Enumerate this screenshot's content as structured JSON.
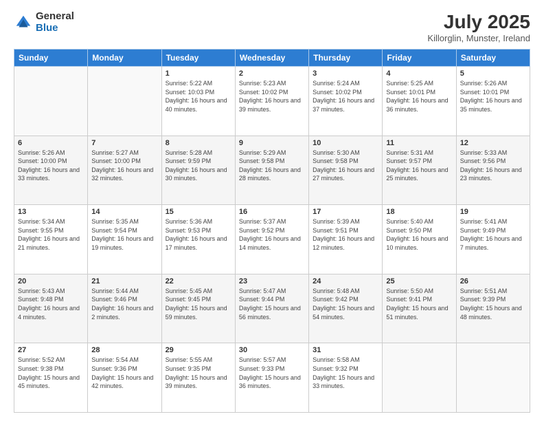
{
  "logo": {
    "general": "General",
    "blue": "Blue"
  },
  "header": {
    "month_year": "July 2025",
    "location": "Killorglin, Munster, Ireland"
  },
  "days_of_week": [
    "Sunday",
    "Monday",
    "Tuesday",
    "Wednesday",
    "Thursday",
    "Friday",
    "Saturday"
  ],
  "weeks": [
    [
      {
        "day": "",
        "sunrise": "",
        "sunset": "",
        "daylight": ""
      },
      {
        "day": "",
        "sunrise": "",
        "sunset": "",
        "daylight": ""
      },
      {
        "day": "1",
        "sunrise": "Sunrise: 5:22 AM",
        "sunset": "Sunset: 10:03 PM",
        "daylight": "Daylight: 16 hours and 40 minutes."
      },
      {
        "day": "2",
        "sunrise": "Sunrise: 5:23 AM",
        "sunset": "Sunset: 10:02 PM",
        "daylight": "Daylight: 16 hours and 39 minutes."
      },
      {
        "day": "3",
        "sunrise": "Sunrise: 5:24 AM",
        "sunset": "Sunset: 10:02 PM",
        "daylight": "Daylight: 16 hours and 37 minutes."
      },
      {
        "day": "4",
        "sunrise": "Sunrise: 5:25 AM",
        "sunset": "Sunset: 10:01 PM",
        "daylight": "Daylight: 16 hours and 36 minutes."
      },
      {
        "day": "5",
        "sunrise": "Sunrise: 5:26 AM",
        "sunset": "Sunset: 10:01 PM",
        "daylight": "Daylight: 16 hours and 35 minutes."
      }
    ],
    [
      {
        "day": "6",
        "sunrise": "Sunrise: 5:26 AM",
        "sunset": "Sunset: 10:00 PM",
        "daylight": "Daylight: 16 hours and 33 minutes."
      },
      {
        "day": "7",
        "sunrise": "Sunrise: 5:27 AM",
        "sunset": "Sunset: 10:00 PM",
        "daylight": "Daylight: 16 hours and 32 minutes."
      },
      {
        "day": "8",
        "sunrise": "Sunrise: 5:28 AM",
        "sunset": "Sunset: 9:59 PM",
        "daylight": "Daylight: 16 hours and 30 minutes."
      },
      {
        "day": "9",
        "sunrise": "Sunrise: 5:29 AM",
        "sunset": "Sunset: 9:58 PM",
        "daylight": "Daylight: 16 hours and 28 minutes."
      },
      {
        "day": "10",
        "sunrise": "Sunrise: 5:30 AM",
        "sunset": "Sunset: 9:58 PM",
        "daylight": "Daylight: 16 hours and 27 minutes."
      },
      {
        "day": "11",
        "sunrise": "Sunrise: 5:31 AM",
        "sunset": "Sunset: 9:57 PM",
        "daylight": "Daylight: 16 hours and 25 minutes."
      },
      {
        "day": "12",
        "sunrise": "Sunrise: 5:33 AM",
        "sunset": "Sunset: 9:56 PM",
        "daylight": "Daylight: 16 hours and 23 minutes."
      }
    ],
    [
      {
        "day": "13",
        "sunrise": "Sunrise: 5:34 AM",
        "sunset": "Sunset: 9:55 PM",
        "daylight": "Daylight: 16 hours and 21 minutes."
      },
      {
        "day": "14",
        "sunrise": "Sunrise: 5:35 AM",
        "sunset": "Sunset: 9:54 PM",
        "daylight": "Daylight: 16 hours and 19 minutes."
      },
      {
        "day": "15",
        "sunrise": "Sunrise: 5:36 AM",
        "sunset": "Sunset: 9:53 PM",
        "daylight": "Daylight: 16 hours and 17 minutes."
      },
      {
        "day": "16",
        "sunrise": "Sunrise: 5:37 AM",
        "sunset": "Sunset: 9:52 PM",
        "daylight": "Daylight: 16 hours and 14 minutes."
      },
      {
        "day": "17",
        "sunrise": "Sunrise: 5:39 AM",
        "sunset": "Sunset: 9:51 PM",
        "daylight": "Daylight: 16 hours and 12 minutes."
      },
      {
        "day": "18",
        "sunrise": "Sunrise: 5:40 AM",
        "sunset": "Sunset: 9:50 PM",
        "daylight": "Daylight: 16 hours and 10 minutes."
      },
      {
        "day": "19",
        "sunrise": "Sunrise: 5:41 AM",
        "sunset": "Sunset: 9:49 PM",
        "daylight": "Daylight: 16 hours and 7 minutes."
      }
    ],
    [
      {
        "day": "20",
        "sunrise": "Sunrise: 5:43 AM",
        "sunset": "Sunset: 9:48 PM",
        "daylight": "Daylight: 16 hours and 4 minutes."
      },
      {
        "day": "21",
        "sunrise": "Sunrise: 5:44 AM",
        "sunset": "Sunset: 9:46 PM",
        "daylight": "Daylight: 16 hours and 2 minutes."
      },
      {
        "day": "22",
        "sunrise": "Sunrise: 5:45 AM",
        "sunset": "Sunset: 9:45 PM",
        "daylight": "Daylight: 15 hours and 59 minutes."
      },
      {
        "day": "23",
        "sunrise": "Sunrise: 5:47 AM",
        "sunset": "Sunset: 9:44 PM",
        "daylight": "Daylight: 15 hours and 56 minutes."
      },
      {
        "day": "24",
        "sunrise": "Sunrise: 5:48 AM",
        "sunset": "Sunset: 9:42 PM",
        "daylight": "Daylight: 15 hours and 54 minutes."
      },
      {
        "day": "25",
        "sunrise": "Sunrise: 5:50 AM",
        "sunset": "Sunset: 9:41 PM",
        "daylight": "Daylight: 15 hours and 51 minutes."
      },
      {
        "day": "26",
        "sunrise": "Sunrise: 5:51 AM",
        "sunset": "Sunset: 9:39 PM",
        "daylight": "Daylight: 15 hours and 48 minutes."
      }
    ],
    [
      {
        "day": "27",
        "sunrise": "Sunrise: 5:52 AM",
        "sunset": "Sunset: 9:38 PM",
        "daylight": "Daylight: 15 hours and 45 minutes."
      },
      {
        "day": "28",
        "sunrise": "Sunrise: 5:54 AM",
        "sunset": "Sunset: 9:36 PM",
        "daylight": "Daylight: 15 hours and 42 minutes."
      },
      {
        "day": "29",
        "sunrise": "Sunrise: 5:55 AM",
        "sunset": "Sunset: 9:35 PM",
        "daylight": "Daylight: 15 hours and 39 minutes."
      },
      {
        "day": "30",
        "sunrise": "Sunrise: 5:57 AM",
        "sunset": "Sunset: 9:33 PM",
        "daylight": "Daylight: 15 hours and 36 minutes."
      },
      {
        "day": "31",
        "sunrise": "Sunrise: 5:58 AM",
        "sunset": "Sunset: 9:32 PM",
        "daylight": "Daylight: 15 hours and 33 minutes."
      },
      {
        "day": "",
        "sunrise": "",
        "sunset": "",
        "daylight": ""
      },
      {
        "day": "",
        "sunrise": "",
        "sunset": "",
        "daylight": ""
      }
    ]
  ]
}
